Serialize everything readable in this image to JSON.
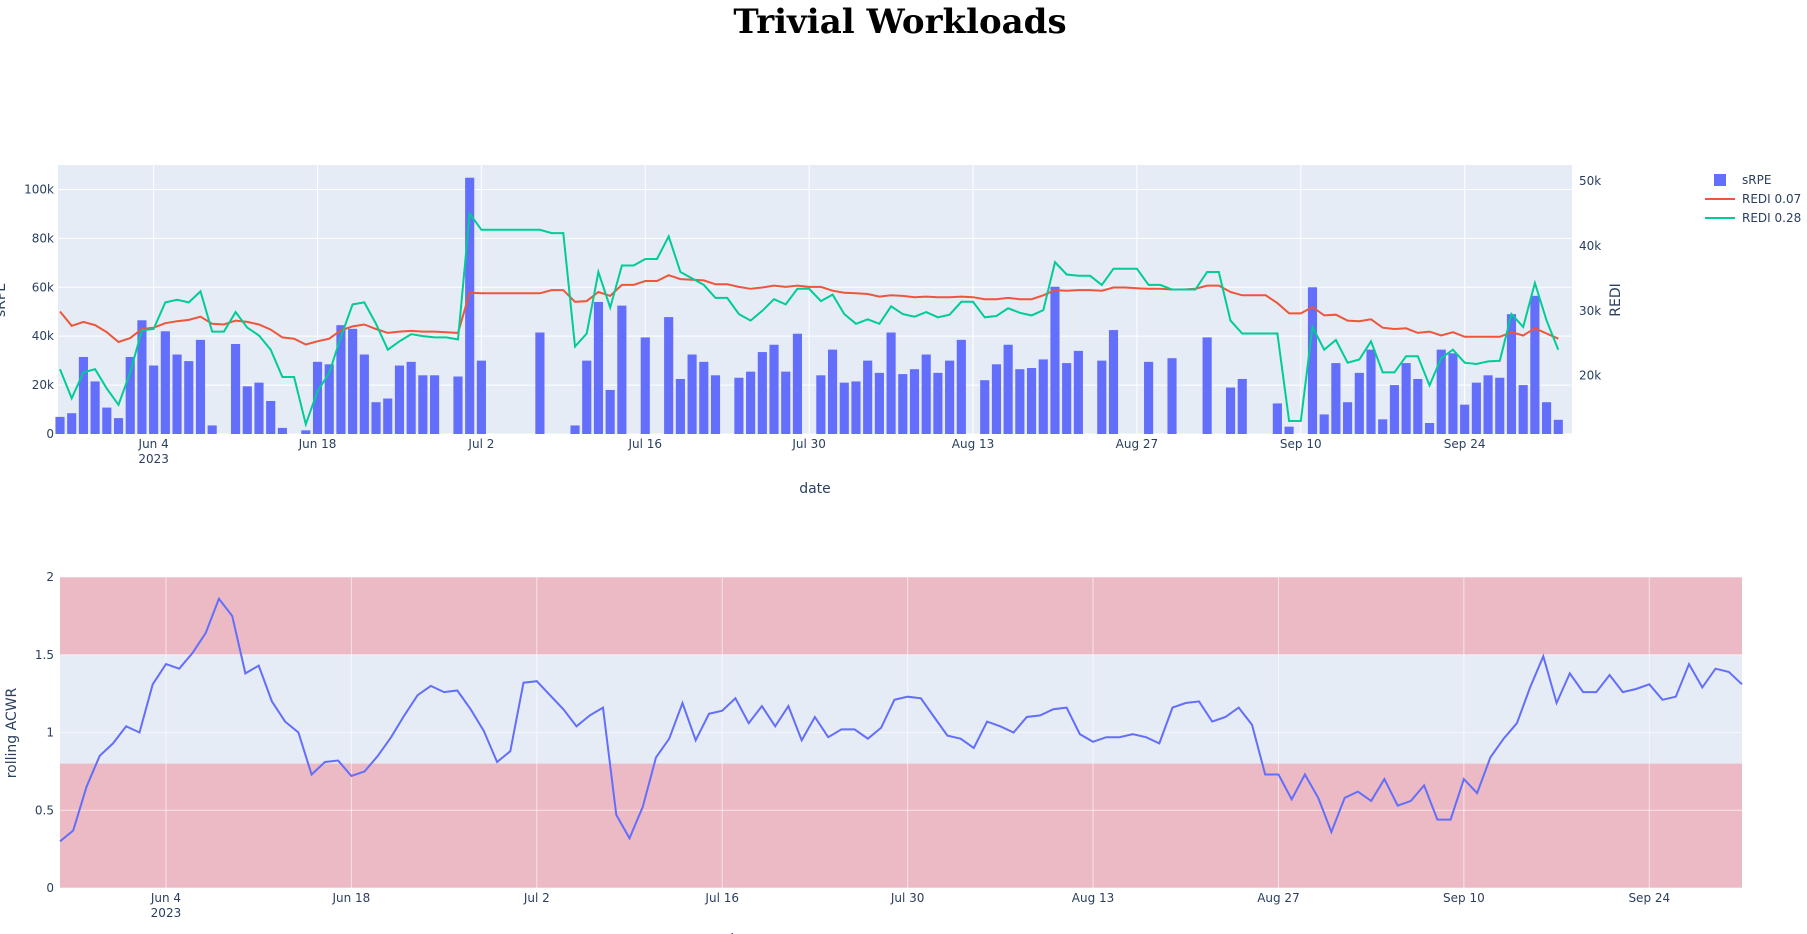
{
  "title": "Trivial Workloads",
  "chart_data": [
    {
      "type": "bar+line",
      "name": "top",
      "x_dates": [
        "2023-05-27",
        "2023-05-28",
        "2023-05-29",
        "2023-05-30",
        "2023-05-31",
        "2023-06-01",
        "2023-06-02",
        "2023-06-03",
        "2023-06-04",
        "2023-06-05",
        "2023-06-06",
        "2023-06-07",
        "2023-06-08",
        "2023-06-09",
        "2023-06-10",
        "2023-06-11",
        "2023-06-12",
        "2023-06-13",
        "2023-06-14",
        "2023-06-15",
        "2023-06-16",
        "2023-06-17",
        "2023-06-18",
        "2023-06-19",
        "2023-06-20",
        "2023-06-21",
        "2023-06-22",
        "2023-06-23",
        "2023-06-24",
        "2023-06-25",
        "2023-06-26",
        "2023-06-27",
        "2023-06-28",
        "2023-06-29",
        "2023-06-30",
        "2023-07-01",
        "2023-07-02",
        "2023-07-03",
        "2023-07-04",
        "2023-07-05",
        "2023-07-06",
        "2023-07-07",
        "2023-07-08",
        "2023-07-09",
        "2023-07-10",
        "2023-07-11",
        "2023-07-12",
        "2023-07-13",
        "2023-07-14",
        "2023-07-15",
        "2023-07-16",
        "2023-07-17",
        "2023-07-18",
        "2023-07-19",
        "2023-07-20",
        "2023-07-21",
        "2023-07-22",
        "2023-07-23",
        "2023-07-24",
        "2023-07-25",
        "2023-07-26",
        "2023-07-27",
        "2023-07-28",
        "2023-07-29",
        "2023-07-30",
        "2023-07-31",
        "2023-08-01",
        "2023-08-02",
        "2023-08-03",
        "2023-08-04",
        "2023-08-05",
        "2023-08-06",
        "2023-08-07",
        "2023-08-08",
        "2023-08-09",
        "2023-08-10",
        "2023-08-11",
        "2023-08-12",
        "2023-08-13",
        "2023-08-14",
        "2023-08-15",
        "2023-08-16",
        "2023-08-17",
        "2023-08-18",
        "2023-08-19",
        "2023-08-20",
        "2023-08-21",
        "2023-08-22",
        "2023-08-23",
        "2023-08-24",
        "2023-08-25",
        "2023-08-26",
        "2023-08-27",
        "2023-08-28",
        "2023-08-29",
        "2023-08-30",
        "2023-08-31",
        "2023-09-01",
        "2023-09-02",
        "2023-09-03",
        "2023-09-04",
        "2023-09-05",
        "2023-09-06",
        "2023-09-07",
        "2023-09-08",
        "2023-09-09",
        "2023-09-10",
        "2023-09-11",
        "2023-09-12",
        "2023-09-13",
        "2023-09-14",
        "2023-09-15",
        "2023-09-16",
        "2023-09-17",
        "2023-09-18",
        "2023-09-19",
        "2023-09-20",
        "2023-09-21",
        "2023-09-22",
        "2023-09-23",
        "2023-09-24",
        "2023-09-25",
        "2023-09-26",
        "2023-09-27",
        "2023-09-28",
        "2023-09-29",
        "2023-09-30",
        "2023-10-01",
        "2023-10-02",
        "2023-10-03"
      ],
      "srpe": [
        7000,
        8500,
        31500,
        21500,
        10800,
        6500,
        31500,
        46500,
        28000,
        42000,
        32500,
        29800,
        38500,
        3500,
        0,
        36800,
        19500,
        21000,
        13500,
        2500,
        0,
        1500,
        29500,
        28500,
        44500,
        43000,
        32500,
        13000,
        14500,
        28000,
        29500,
        24000,
        24000,
        0,
        23500,
        104800,
        30000,
        0,
        0,
        0,
        0,
        41500,
        0,
        0,
        3500,
        30000,
        54000,
        18000,
        52500,
        0,
        39500,
        0,
        47800,
        22500,
        32500,
        29500,
        24000,
        0,
        23000,
        25500,
        33500,
        36500,
        25500,
        41000,
        0,
        24000,
        34500,
        21000,
        21500,
        30000,
        25000,
        41500,
        24500,
        26500,
        32500,
        25000,
        30000,
        38500,
        0,
        22000,
        28500,
        36500,
        26500,
        27000,
        30500,
        60200,
        29000,
        34000,
        0,
        30000,
        42500,
        0,
        0,
        29500,
        0,
        31000,
        0,
        0,
        39500,
        0,
        19000,
        22500,
        0,
        0,
        12500,
        3000,
        0,
        60000,
        8000,
        29000,
        13000,
        25000,
        34500,
        6000,
        20000,
        29000,
        22500,
        4500,
        34500,
        33000,
        12000,
        21000,
        24000,
        23000,
        49000,
        20000,
        56500,
        13000,
        5800,
        0
      ],
      "redi_007": [
        29900,
        27700,
        28300,
        27800,
        26700,
        25200,
        25800,
        27200,
        27400,
        28100,
        28400,
        28600,
        29100,
        28000,
        27900,
        28500,
        28300,
        27900,
        27100,
        25900,
        25700,
        24800,
        25300,
        25700,
        27000,
        27600,
        27900,
        27200,
        26600,
        26800,
        26900,
        26800,
        26800,
        26700,
        26600,
        32800,
        32700,
        32700,
        32700,
        32700,
        32700,
        32700,
        33200,
        33200,
        31400,
        31500,
        32900,
        32300,
        34000,
        34000,
        34600,
        34600,
        35500,
        34900,
        34800,
        34700,
        34100,
        34100,
        33700,
        33400,
        33600,
        33900,
        33700,
        33900,
        33700,
        33700,
        33100,
        32800,
        32700,
        32600,
        32200,
        32400,
        32300,
        32100,
        32200,
        32100,
        32100,
        32200,
        32100,
        31800,
        31800,
        32000,
        31800,
        31800,
        32400,
        33200,
        33100,
        33200,
        33200,
        33100,
        33600,
        33600,
        33500,
        33400,
        33400,
        33300,
        33300,
        33400,
        33900,
        33900,
        32900,
        32400,
        32400,
        32400,
        31200,
        29600,
        29600,
        30600,
        29300,
        29400,
        28500,
        28400,
        28700,
        27400,
        27200,
        27300,
        26600,
        26800,
        26200,
        26700,
        26000,
        26000,
        26000,
        26000,
        26700,
        26200,
        27300,
        26500,
        25700
      ],
      "redi_028": [
        21000,
        16500,
        20500,
        21000,
        18000,
        15500,
        20500,
        27000,
        27200,
        31300,
        31700,
        31300,
        33000,
        26800,
        26800,
        29800,
        27400,
        26200,
        24000,
        19800,
        19800,
        12500,
        17600,
        20400,
        26000,
        31000,
        31300,
        28000,
        24000,
        25300,
        26400,
        26100,
        25900,
        25900,
        25600,
        45000,
        42500,
        42500,
        42500,
        42500,
        42500,
        42500,
        42000,
        42000,
        24500,
        26500,
        36000,
        30500,
        37000,
        37000,
        38000,
        38000,
        41500,
        36000,
        35000,
        34000,
        32000,
        32000,
        29500,
        28500,
        30000,
        31800,
        31000,
        33400,
        33400,
        31500,
        32500,
        29500,
        28000,
        28700,
        28000,
        30700,
        29500,
        29100,
        29800,
        29000,
        29400,
        31400,
        31400,
        29000,
        29200,
        30400,
        29700,
        29300,
        30100,
        37500,
        35600,
        35400,
        35400,
        34000,
        36500,
        36500,
        36500,
        34000,
        34000,
        33300,
        33300,
        33300,
        36000,
        36000,
        28500,
        26500,
        26500,
        26500,
        26500,
        13000,
        13000,
        27500,
        24000,
        25500,
        22000,
        22500,
        25300,
        20500,
        20500,
        23000,
        23000,
        18500,
        22700,
        24000,
        22000,
        21800,
        22200,
        22300,
        29500,
        27500,
        34300,
        28500,
        24000
      ],
      "x_ticks": [
        "2023-06-04",
        "2023-06-18",
        "2023-07-02",
        "2023-07-16",
        "2023-07-30",
        "2023-08-13",
        "2023-08-27",
        "2023-09-10",
        "2023-09-24"
      ],
      "x_tick_labels": [
        "Jun 4",
        "Jun 18",
        "Jul 2",
        "Jul 16",
        "Jul 30",
        "Aug 13",
        "Aug 27",
        "Sep 10",
        "Sep 24"
      ],
      "x_year_label": "2023",
      "y_ticks": [
        0,
        20000,
        40000,
        60000,
        80000,
        100000
      ],
      "y_tick_labels": [
        "0",
        "20k",
        "40k",
        "60k",
        "80k",
        "100k"
      ],
      "y2_ticks": [
        20000,
        30000,
        40000,
        50000
      ],
      "y2_tick_labels": [
        "20k",
        "30k",
        "40k",
        "50k"
      ],
      "ylim": [
        0,
        110000
      ],
      "y2lim": [
        11000,
        52500
      ],
      "xlabel": "date",
      "ylabel": "sRPE",
      "y2label": "REDI",
      "legend": [
        "sRPE",
        "REDI 0.07",
        "REDI 0.28"
      ],
      "legend_position": "right",
      "colors": {
        "bar": "#636efa",
        "redi_007": "#ef553b",
        "redi_028": "#00cc96",
        "plot_bg": "#e5ecf6",
        "grid": "#ffffff"
      }
    },
    {
      "type": "line",
      "name": "bottom",
      "x_start": "2023-05-27",
      "values": [
        0.3,
        0.37,
        0.65,
        0.85,
        0.93,
        1.04,
        1.0,
        1.31,
        1.44,
        1.41,
        1.51,
        1.64,
        1.86,
        1.75,
        1.38,
        1.43,
        1.2,
        1.07,
        1.0,
        0.73,
        0.81,
        0.82,
        0.72,
        0.75,
        0.85,
        0.97,
        1.11,
        1.24,
        1.3,
        1.26,
        1.27,
        1.15,
        1.01,
        0.81,
        0.88,
        1.32,
        1.33,
        1.24,
        1.15,
        1.04,
        1.11,
        1.16,
        0.47,
        0.32,
        0.52,
        0.84,
        0.96,
        1.19,
        0.95,
        1.12,
        1.14,
        1.22,
        1.06,
        1.17,
        1.04,
        1.17,
        0.95,
        1.1,
        0.97,
        1.02,
        1.02,
        0.96,
        1.03,
        1.21,
        1.23,
        1.22,
        1.1,
        0.98,
        0.96,
        0.9,
        1.07,
        1.04,
        1.0,
        1.1,
        1.11,
        1.15,
        1.16,
        0.99,
        0.94,
        0.97,
        0.97,
        0.99,
        0.97,
        0.93,
        1.16,
        1.19,
        1.2,
        1.07,
        1.1,
        1.16,
        1.05,
        0.73,
        0.73,
        0.57,
        0.73,
        0.58,
        0.36,
        0.58,
        0.62,
        0.56,
        0.7,
        0.53,
        0.56,
        0.66,
        0.44,
        0.44,
        0.7,
        0.61,
        0.84,
        0.96,
        1.06,
        1.29,
        1.49,
        1.19,
        1.38,
        1.26,
        1.26,
        1.37,
        1.26,
        1.28,
        1.31,
        1.21,
        1.23,
        1.44,
        1.29,
        1.41,
        1.39,
        1.31
      ],
      "x_ticks": [
        "2023-06-04",
        "2023-06-18",
        "2023-07-02",
        "2023-07-16",
        "2023-07-30",
        "2023-08-13",
        "2023-08-27",
        "2023-09-10",
        "2023-09-24"
      ],
      "x_tick_labels": [
        "Jun 4",
        "Jun 18",
        "Jul 2",
        "Jul 16",
        "Jul 30",
        "Aug 13",
        "Aug 27",
        "Sep 10",
        "Sep 24"
      ],
      "x_year_label": "2023",
      "y_ticks": [
        0,
        0.5,
        1,
        1.5,
        2
      ],
      "y_tick_labels": [
        "0",
        "0.5",
        "1",
        "1.5",
        "2"
      ],
      "ylim": [
        0,
        2
      ],
      "ylabel": "rolling ACWR",
      "xlabel": "date",
      "bands": [
        {
          "from": 0,
          "to": 0.8,
          "color": "#ebbac4"
        },
        {
          "from": 1.5,
          "to": 2,
          "color": "#ebbac4"
        }
      ],
      "colors": {
        "line": "#636efa",
        "plot_bg": "#e5ecf6",
        "grid": "#ffffff"
      }
    }
  ]
}
